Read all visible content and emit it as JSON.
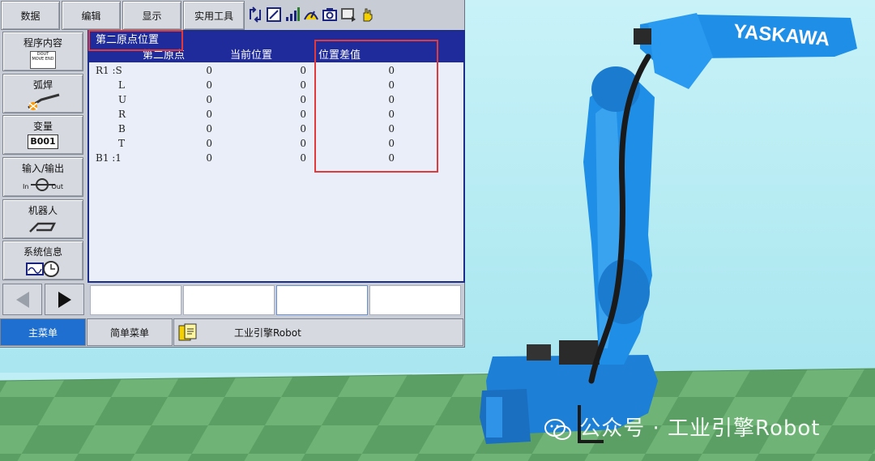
{
  "menu": {
    "data": "数据",
    "edit": "编辑",
    "display": "显示",
    "utility": "实用工具"
  },
  "toolbar": {
    "icons": [
      "cycle-icon",
      "edit-icon",
      "signal-icon",
      "speed-icon",
      "camera-icon",
      "monitor-icon",
      "hand-icon"
    ]
  },
  "sidebar": {
    "items": [
      {
        "label": "程序内容",
        "icon": "program-content-icon",
        "icon_text": "DOUT MOVE END"
      },
      {
        "label": "弧焊",
        "icon": "arc-welding-icon"
      },
      {
        "label": "变量",
        "icon": "variable-icon",
        "icon_text": "B001"
      },
      {
        "label": "输入/输出",
        "icon": "io-icon",
        "in_text": "In",
        "out_text": "Out"
      },
      {
        "label": "机器人",
        "icon": "robot-icon"
      },
      {
        "label": "系统信息",
        "icon": "system-info-icon"
      }
    ]
  },
  "window": {
    "title": "第二原点位置",
    "columns": [
      "第二原点",
      "当前位置",
      "位置差值"
    ],
    "rows": [
      {
        "axis": "R1 :S",
        "second_home": "0",
        "current": "0",
        "diff": "0"
      },
      {
        "axis": "L",
        "second_home": "0",
        "current": "0",
        "diff": "0"
      },
      {
        "axis": "U",
        "second_home": "0",
        "current": "0",
        "diff": "0"
      },
      {
        "axis": "R",
        "second_home": "0",
        "current": "0",
        "diff": "0"
      },
      {
        "axis": "B",
        "second_home": "0",
        "current": "0",
        "diff": "0"
      },
      {
        "axis": "T",
        "second_home": "0",
        "current": "0",
        "diff": "0"
      },
      {
        "axis": "B1 :1",
        "second_home": "0",
        "current": "0",
        "diff": "0"
      }
    ]
  },
  "bottom": {
    "main_menu": "主菜单",
    "simple_menu": "简单菜单",
    "status_text": "工业引擎Robot"
  },
  "robot": {
    "brand": "YASKAWA"
  },
  "watermark": {
    "text": "公众号 · 工业引擎Robot"
  },
  "colors": {
    "title_bar": "#1f2b9a",
    "sky": "#bfeef6",
    "robot_blue": "#1f8ee6",
    "floor_dark": "#5a9e62",
    "floor_light": "#7cbf84",
    "highlight_red": "#e23a3a"
  }
}
